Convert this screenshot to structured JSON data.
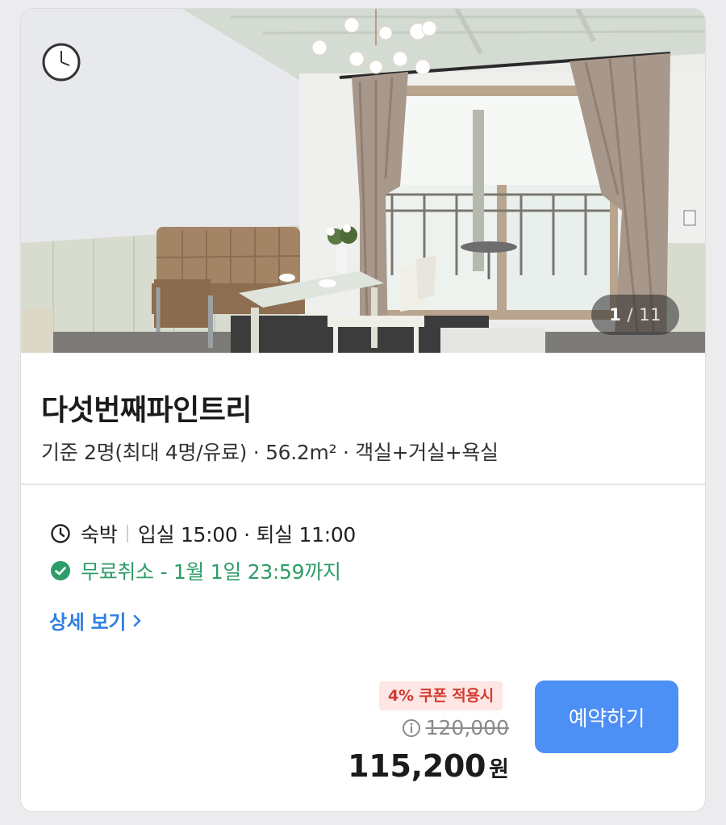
{
  "gallery": {
    "current": "1",
    "separator": "/",
    "total": "11"
  },
  "room": {
    "name": "다섯번째파인트리",
    "summary": "기준 2명(최대 4명/유료) · 56.2m² · 객실+거실+욕실"
  },
  "stay": {
    "type": "숙박",
    "times": "입실 15:00 · 퇴실 11:00",
    "free_cancel": "무료취소 - 1월 1일 23:59까지",
    "detail_link": "상세 보기"
  },
  "pricing": {
    "coupon": "4% 쿠폰 적용시",
    "original": "120,000",
    "final": "115,200",
    "currency": "원"
  },
  "reserve_label": "예약하기",
  "icons": {
    "clock": "clock-icon",
    "check": "check-circle-icon",
    "chevron": "chevron-right-icon",
    "info": "info-icon"
  },
  "colors": {
    "accent": "#4c8ff5",
    "success": "#2e9c67",
    "coupon": "#d23b2f",
    "link": "#2f7fe0"
  }
}
